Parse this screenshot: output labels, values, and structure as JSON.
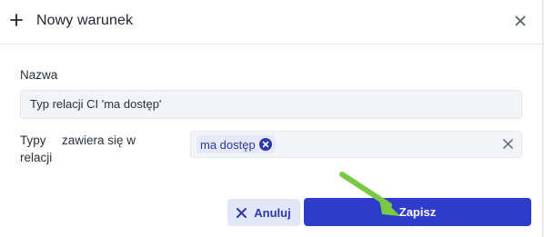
{
  "dialog": {
    "title": "Nowy warunek",
    "icons": {
      "header": "plus-icon",
      "close": "close-icon"
    }
  },
  "form": {
    "name_label": "Nazwa",
    "name_value": "Typ relacji CI 'ma dostęp'",
    "types_label_line1": "Typy",
    "types_label_line2": "relacji",
    "operator_label": "zawiera się w",
    "tags": [
      {
        "label": "ma dostęp"
      }
    ]
  },
  "buttons": {
    "cancel_label": "Anuluj",
    "save_label": "Zapisz"
  },
  "colors": {
    "primary": "#2f3ccb",
    "tag_bg": "#e6e9fa",
    "tag_text": "#2b3aa8",
    "annotation_arrow": "#7ac943"
  }
}
